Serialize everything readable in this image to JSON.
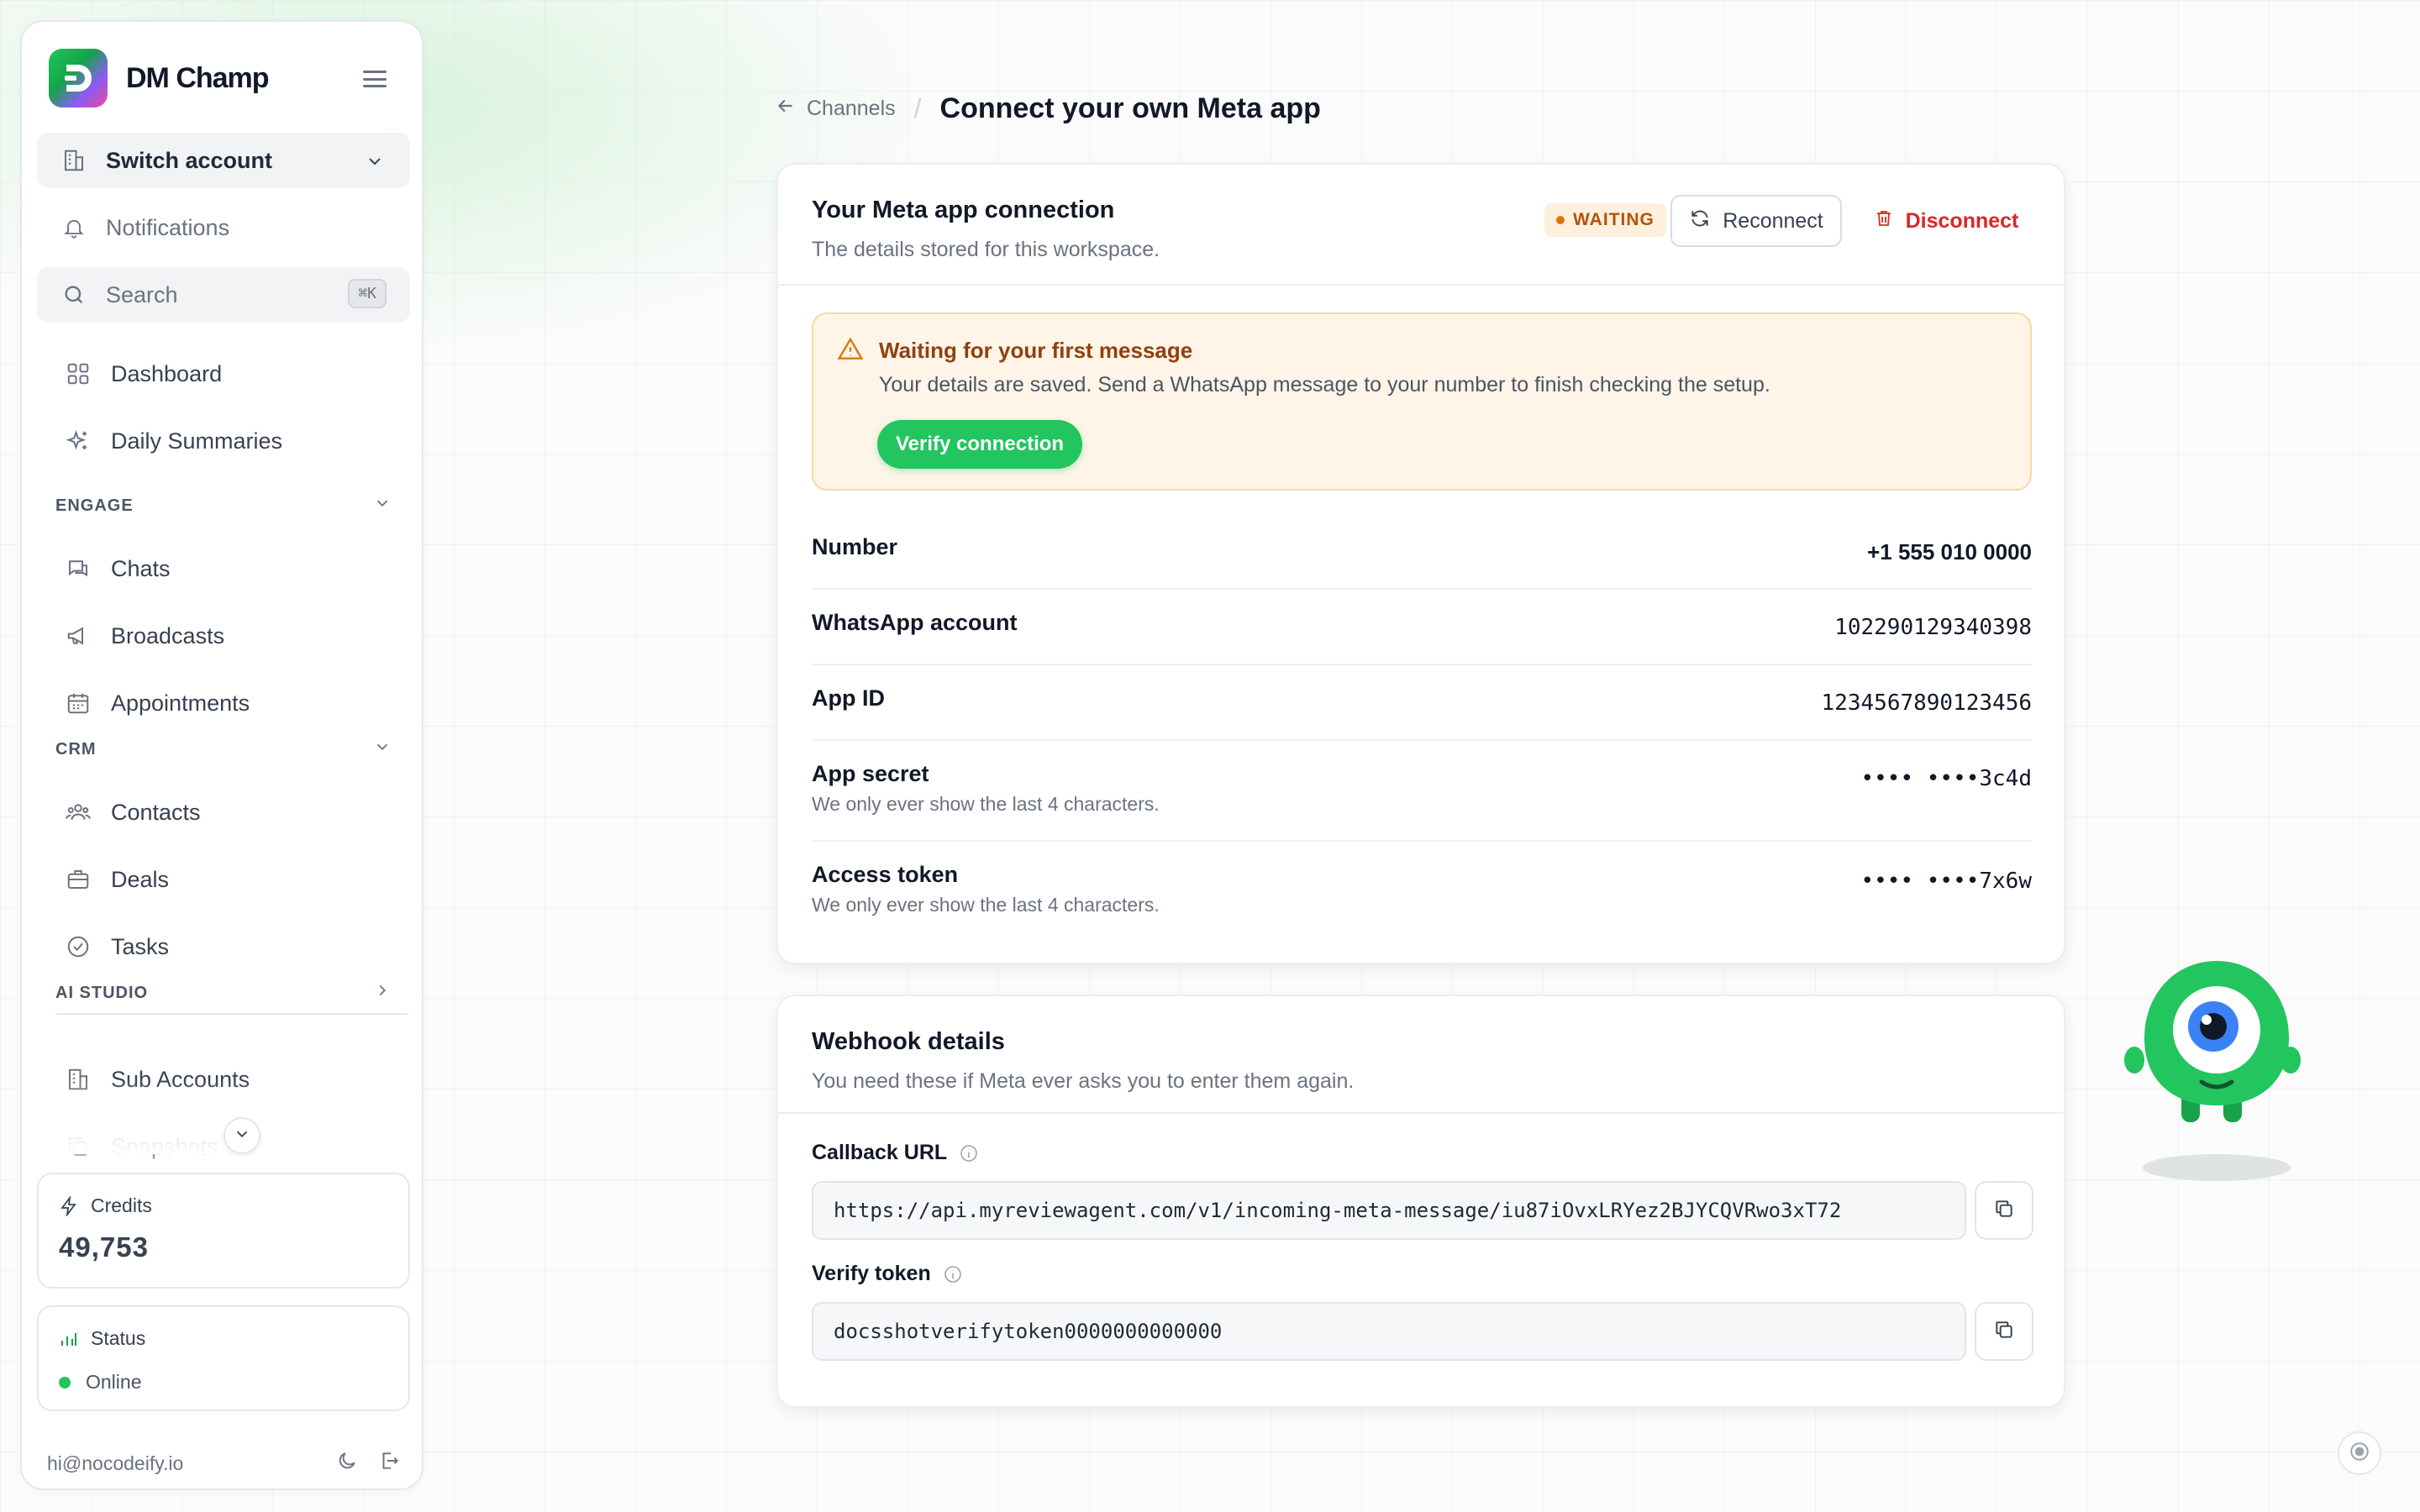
{
  "sidebar": {
    "brand_name": "DM Champ",
    "switch_account": "Switch account",
    "notifications": "Notifications",
    "search_placeholder": "Search",
    "search_shortcut": "⌘K",
    "nav": {
      "dashboard": "Dashboard",
      "daily_summaries": "Daily Summaries",
      "chats": "Chats",
      "broadcasts": "Broadcasts",
      "appointments": "Appointments",
      "contacts": "Contacts",
      "deals": "Deals",
      "tasks": "Tasks",
      "sub_accounts": "Sub Accounts",
      "snapshots": "Snapshots"
    },
    "sections": {
      "engage": "ENGAGE",
      "crm": "CRM",
      "ai_studio": "AI STUDIO"
    },
    "credits": {
      "label": "Credits",
      "value": "49,753"
    },
    "status": {
      "label": "Status",
      "value": "Online"
    },
    "footer_email": "hi@nocodeify.io"
  },
  "breadcrumb": {
    "back": "Channels",
    "title": "Connect your own Meta app"
  },
  "connection": {
    "title": "Your Meta app connection",
    "subtitle": "The details stored for this workspace.",
    "badge": "WAITING",
    "reconnect": "Reconnect",
    "disconnect": "Disconnect",
    "alert": {
      "title": "Waiting for your first message",
      "text": "Your details are saved. Send a WhatsApp message to your number to finish checking the setup.",
      "button": "Verify connection"
    },
    "rows": [
      {
        "label": "Number",
        "value": "+1 555 010 0000",
        "hint": ""
      },
      {
        "label": "WhatsApp account",
        "value": "102290129340398",
        "hint": ""
      },
      {
        "label": "App ID",
        "value": "1234567890123456",
        "hint": ""
      },
      {
        "label": "App secret",
        "value": "•••• ••••3c4d",
        "hint": "We only ever show the last 4 characters."
      },
      {
        "label": "Access token",
        "value": "•••• ••••7x6w",
        "hint": "We only ever show the last 4 characters."
      }
    ]
  },
  "webhook": {
    "title": "Webhook details",
    "subtitle": "You need these if Meta ever asks you to enter them again.",
    "callback_label": "Callback URL",
    "callback_value": "https://api.myreviewagent.com/v1/incoming-meta-message/iu87iOvxLRYez2BJYCQVRwo3xT72",
    "verify_label": "Verify token",
    "verify_value": "docsshotverifytoken0000000000000"
  },
  "colors": {
    "accent": "#22c55e",
    "warning": "#d97706",
    "danger": "#dc2626"
  }
}
